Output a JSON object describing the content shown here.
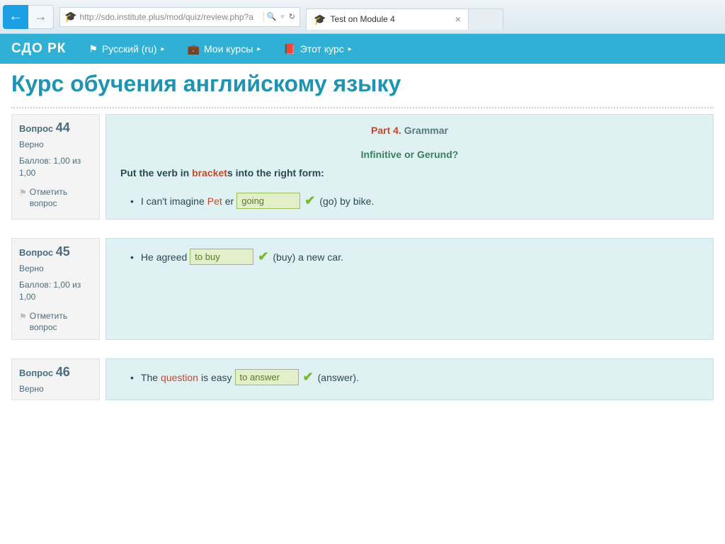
{
  "browser": {
    "url": "http://sdo.institute.plus/mod/quiz/review.php?a",
    "search_icon": "🔍",
    "refresh_icon": "↻",
    "tab_title": "Test on Module 4"
  },
  "sitebar": {
    "brand": "СДО РК",
    "lang": "Русский (ru)",
    "my_courses": "Мои курсы",
    "this_course": "Этот курс"
  },
  "page": {
    "title": "Курс обучения английскому языку"
  },
  "labels": {
    "question": "Вопрос",
    "correct": "Верно",
    "grade_prefix": "Баллов: 1,00 из 1,00",
    "flag": "Отметить вопрос"
  },
  "q44": {
    "num": "44",
    "part_a": "Part 4.",
    "part_b": " Grammar",
    "sub": "Infinitive or Gerund?",
    "instr_a": "Put the verb in ",
    "instr_b": "bracket",
    "instr_c": "s into the right form:",
    "s1a": "I can't imagine ",
    "s1p": "Pet",
    "s1p2": "er ",
    "ans": "going",
    "s1b": " (go) by bike."
  },
  "q45": {
    "num": "45",
    "s1a": "He agreed ",
    "ans": "to buy",
    "s1b": " (buy) a new car."
  },
  "q46": {
    "num": "46",
    "s1a": "The ",
    "s1q": "question",
    "s1b": " is easy ",
    "ans": "to answer",
    "s1c": " (answer)."
  }
}
